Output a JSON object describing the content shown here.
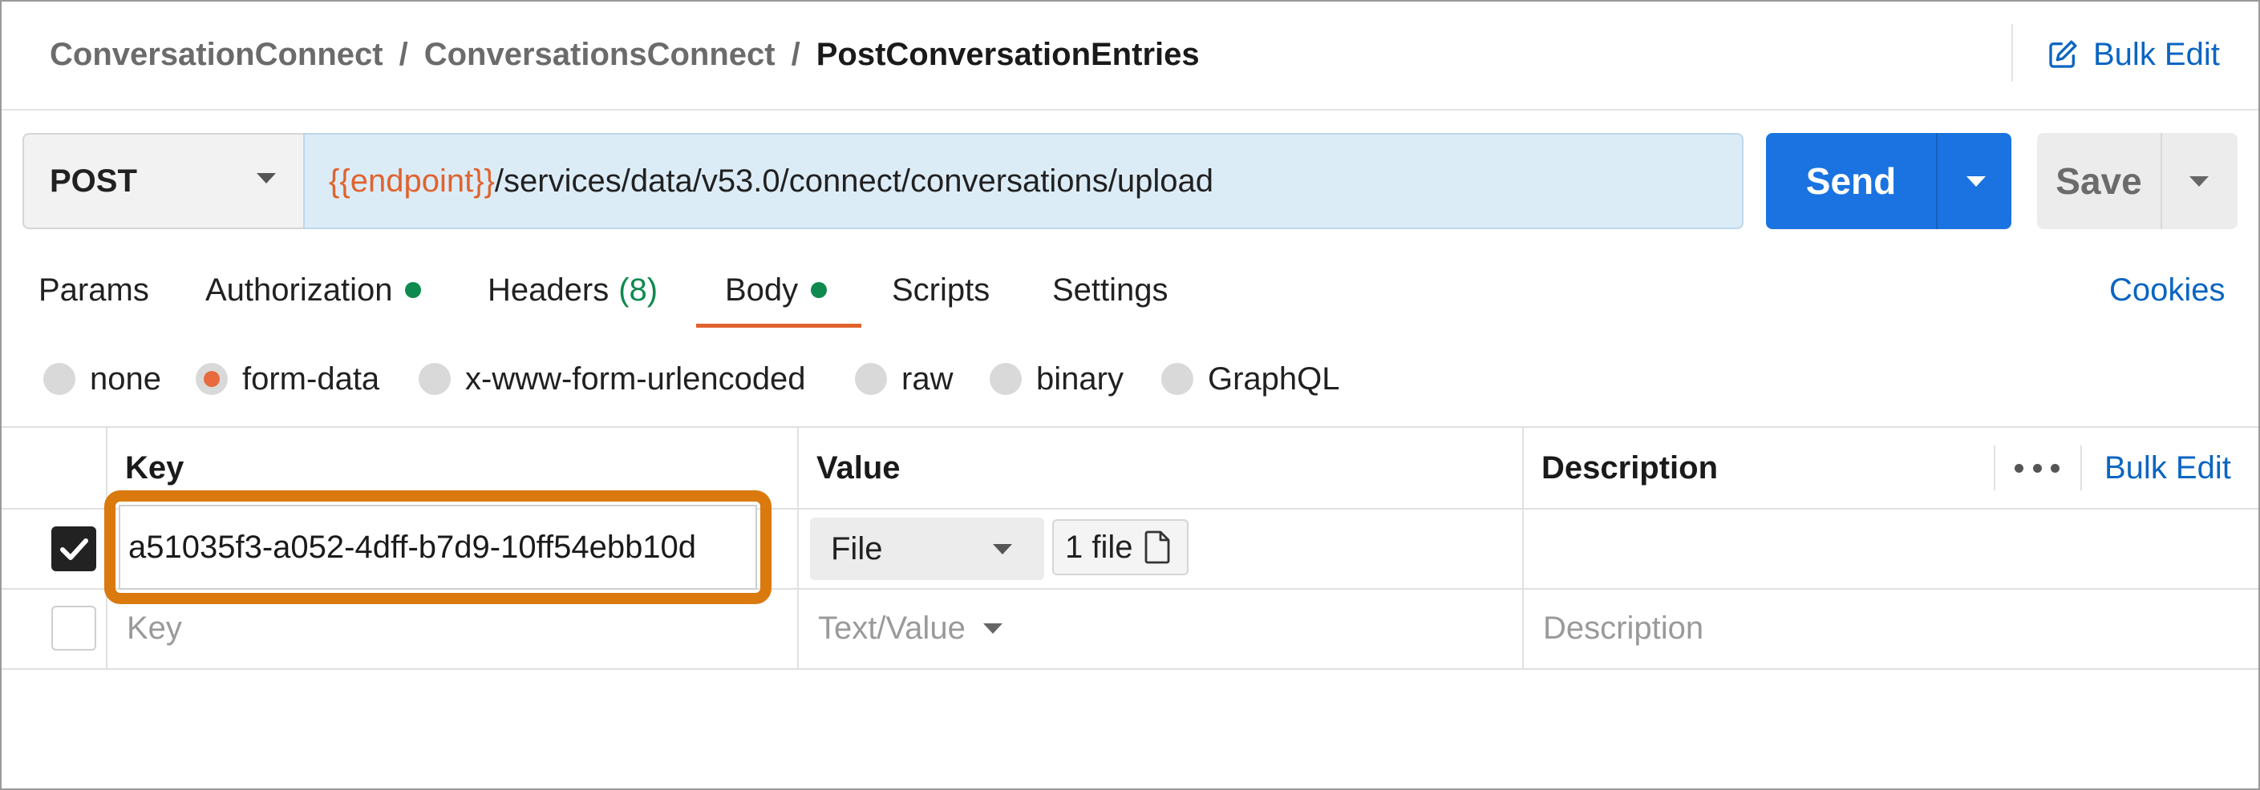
{
  "breadcrumb": {
    "items": [
      "ConversationConnect",
      "ConversationsConnect"
    ],
    "separator": "/",
    "current": "PostConversationEntries"
  },
  "header": {
    "bulk_edit_label": "Bulk Edit",
    "bulk_edit_icon": "edit-icon"
  },
  "request": {
    "method": "POST",
    "url_variable": "{{endpoint}}",
    "url_path": "/services/data/v53.0/connect/conversations/upload",
    "send_label": "Send",
    "save_label": "Save"
  },
  "tabs": {
    "items": [
      {
        "label": "Params"
      },
      {
        "label": "Authorization",
        "indicator": true
      },
      {
        "label": "Headers",
        "count": "(8)"
      },
      {
        "label": "Body",
        "indicator": true,
        "active": true
      },
      {
        "label": "Scripts"
      },
      {
        "label": "Settings"
      }
    ],
    "cookies_label": "Cookies",
    "indicator_color": "#0e8a4e",
    "active_underline_color": "#e0632e"
  },
  "body_types": {
    "options": [
      "none",
      "form-data",
      "x-www-form-urlencoded",
      "raw",
      "binary",
      "GraphQL"
    ],
    "selected": "form-data"
  },
  "table": {
    "headers": {
      "key": "Key",
      "value": "Value",
      "description": "Description"
    },
    "more_icon": "more-horizontal-icon",
    "bulk_edit_label": "Bulk Edit",
    "rows": [
      {
        "checked": true,
        "key": "a51035f3-a052-4dff-b7d9-10ff54ebb10d",
        "value_type": "File",
        "value": "1 file",
        "value_icon": "file-icon",
        "description": ""
      }
    ],
    "new_row": {
      "checked": false,
      "key_placeholder": "Key",
      "value_type_placeholder": "Text/Value",
      "description_placeholder": "Description"
    }
  },
  "highlight": {
    "color": "#d9790e",
    "target": "key-field"
  },
  "colors": {
    "link": "#0b65c2",
    "send": "#1a73e0",
    "url_background": "#dcecf7",
    "url_variable": "#e0632e"
  }
}
